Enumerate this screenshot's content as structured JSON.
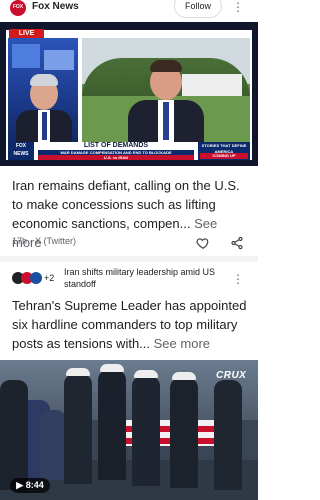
{
  "source1": {
    "logo_text": "FOX",
    "name": "Fox News",
    "follow_label": "Follow",
    "menu_glyph": "⋮"
  },
  "hero": {
    "live_label": "LIVE",
    "lower_third_title": "LIST OF DEMANDS",
    "lower_third_sub": "WAR DAMAGE COMPENSATION AND END TO BLOCKADE",
    "lower_third_bar": "U.S. vs IRAN",
    "fox_logo_top": "FOX",
    "fox_logo_bottom": "NEWS",
    "promo_top": "STORIES THAT DEFINE AMERICA",
    "promo_bottom": "COMING UP"
  },
  "article1": {
    "headline": "Iran remains defiant, calling on the U.S. to make concessions such as lifting economic sanctions, compen...",
    "see_more": "See more",
    "meta": "17h · X (Twitter)",
    "like_icon": "heart-icon",
    "share_icon": "share-icon"
  },
  "article2": {
    "source_count": "+2",
    "source_title": "Iran shifts military leadership amid US standoff",
    "menu_glyph": "⋮",
    "headline": "Tehran's Supreme Leader has appointed six hardline commanders to top military posts as tensions with...",
    "see_more": "See more"
  },
  "video": {
    "watermark": "CRUX",
    "duration": "8:44",
    "play_icon": "play-icon"
  },
  "colors": {
    "fox_red": "#c8102e",
    "fox_navy": "#0c2a6b",
    "divider": "#f1f3f4",
    "meta_gray": "#5f6368"
  }
}
